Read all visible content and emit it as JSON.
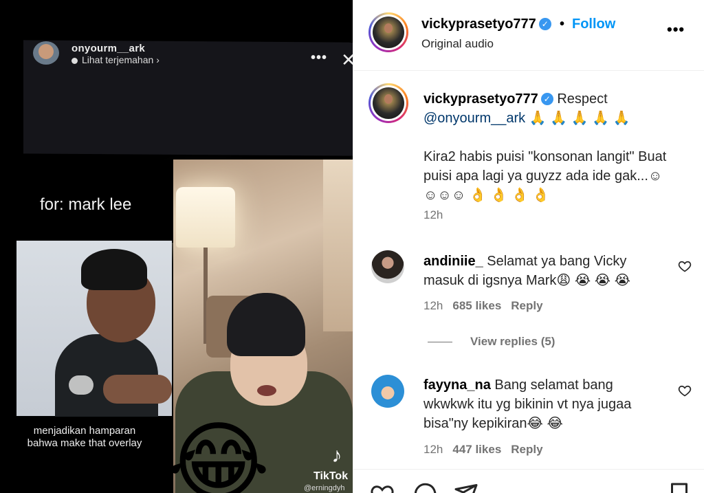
{
  "media": {
    "overlay_user": "onyourm__ark",
    "overlay_translate": "Lihat terjemahan",
    "overlay_translate_chevron": "›",
    "more_glyph": "•••",
    "close_glyph": "✕",
    "for_label": "for: mark lee",
    "caption_text": "menjadikan hamparan bahwa make that overlay",
    "emoji": "😂",
    "tiktok_note": "♪",
    "tiktok_label": "TikTok",
    "tiktok_user": "@erningdyh"
  },
  "header": {
    "username": "vickyprasetyo777",
    "verified_glyph": "✓",
    "separator": "•",
    "follow_label": "Follow",
    "audio": "Original audio",
    "more_glyph": "•••"
  },
  "caption": {
    "username": "vickyprasetyo777",
    "verified_glyph": "✓",
    "line1": "Respect",
    "mention": "@onyourm__ark",
    "line1_emoji": "🙏 🙏 🙏 🙏 🙏",
    "line2": "Kira2 habis puisi \"konsonan langit\" Buat puisi apa lagi ya guyzz ada ide gak...☺☺☺☺",
    "line2_emoji": "👌 👌 👌 👌",
    "time": "12h"
  },
  "comments": [
    {
      "username": "andiniie_",
      "text": "Selamat ya bang Vicky masuk di igsnya Mark",
      "emoji": "😩 😭 😭 😭",
      "time": "12h",
      "likes": "685 likes",
      "reply": "Reply"
    },
    {
      "username": "fayyna_na",
      "text": "Bang selamat bang wkwkwk itu yg bikinin vt nya jugaa bisa\"ny kepikiran",
      "emoji": "😂 😂",
      "time": "12h",
      "likes": "447 likes",
      "reply": "Reply"
    }
  ],
  "view_replies": "View replies (5)",
  "colors": {
    "accent": "#0095f6",
    "verified": "#3897f0",
    "muted": "#737373",
    "mention": "#00376b"
  },
  "icons": [
    "heart-icon",
    "comment-icon",
    "share-icon",
    "bookmark-icon",
    "more-icon",
    "verified-badge-icon"
  ]
}
